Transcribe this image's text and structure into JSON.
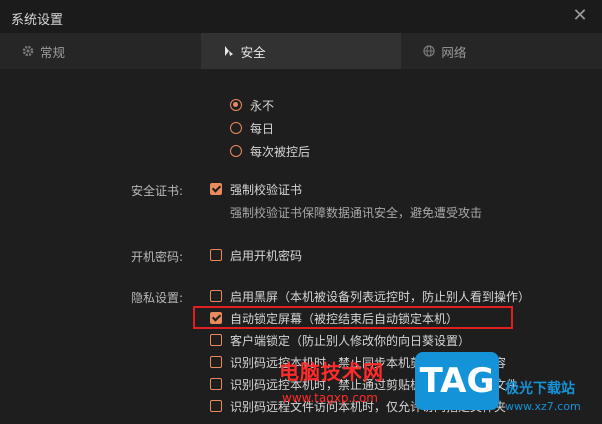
{
  "window": {
    "title": "系统设置",
    "close": "✕"
  },
  "tabs": [
    {
      "label": "常规",
      "icon": "gear-icon",
      "active": false
    },
    {
      "label": "安全",
      "icon": "shield-icon",
      "active": true
    },
    {
      "label": "网络",
      "icon": "globe-icon",
      "active": false
    }
  ],
  "lock_options": [
    {
      "label": "永不",
      "selected": true
    },
    {
      "label": "每日",
      "selected": false
    },
    {
      "label": "每次被控后",
      "selected": false
    }
  ],
  "cert": {
    "label": "安全证书:",
    "option": "强制校验证书",
    "checked": true,
    "desc": "强制校验证书保障数据通讯安全，避免遭受攻击"
  },
  "boot": {
    "label": "开机密码:",
    "option": "启用开机密码",
    "checked": false
  },
  "privacy": {
    "label": "隐私设置:",
    "items": [
      {
        "label": "启用黑屏（本机被设备列表远控时，防止别人看到操作）",
        "checked": false
      },
      {
        "label": "自动锁定屏幕（被控结束后自动锁定本机）",
        "checked": true
      },
      {
        "label": "客户端锁定（防止别人修改你的向日葵设置）",
        "checked": false
      },
      {
        "label": "识别码远控本机时，禁止同步本机剪贴板的文字内容",
        "checked": false
      },
      {
        "label": "识别码远控本机时，禁止通过剪贴板进行文件传输文件",
        "checked": false
      },
      {
        "label": "识别码远程文件访问本机时，仅允许访问指定文件夹",
        "checked": false
      }
    ]
  },
  "watermark": {
    "text": "电脑技术网",
    "url": "www.tagxp.com",
    "logo": "TAG",
    "site": "极光下载站",
    "site2": "www.xz7.com"
  },
  "colors": {
    "accent": "#e88a5c",
    "highlight": "#e02020",
    "bg": "#1e1e1e"
  }
}
